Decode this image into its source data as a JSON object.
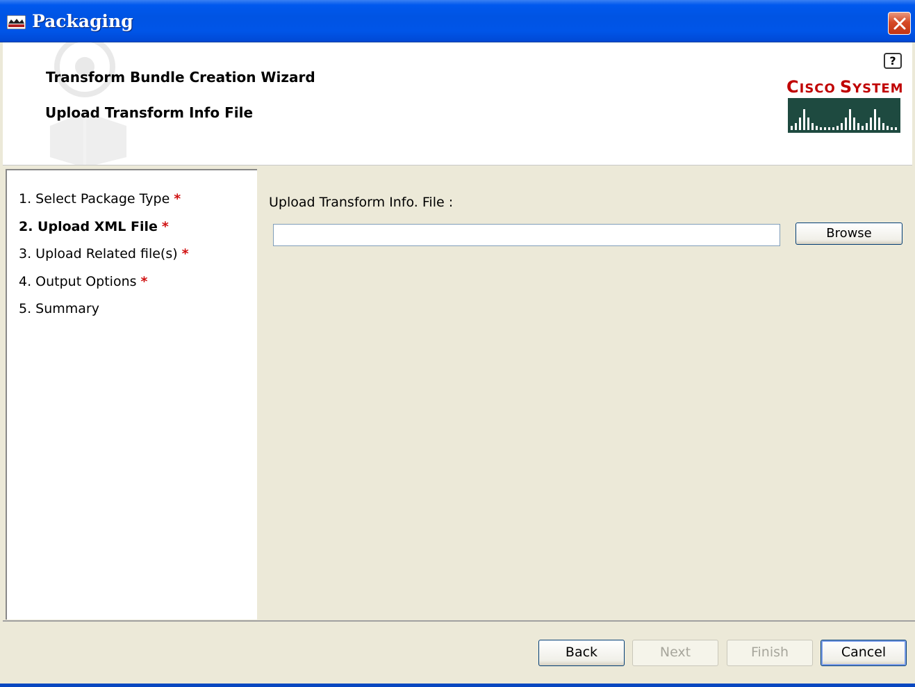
{
  "window": {
    "title": "Packaging",
    "app_icon": "packaging-app-icon",
    "close_icon": "close-icon"
  },
  "header": {
    "wizard_title": "Transform Bundle Creation Wizard",
    "step_title": "Upload Transform Info File",
    "help_label": "?",
    "logo_text": "Cisco Systems"
  },
  "steps": [
    {
      "label": "1. Select Package Type",
      "required": "*",
      "current": false
    },
    {
      "label": "2. Upload XML File",
      "required": "*",
      "current": true
    },
    {
      "label": "3. Upload Related file(s)",
      "required": "*",
      "current": false
    },
    {
      "label": "4. Output Options",
      "required": "*",
      "current": false
    },
    {
      "label": "5. Summary",
      "required": "",
      "current": false
    }
  ],
  "content": {
    "upload_label": "Upload Transform Info. File :",
    "file_value": "",
    "browse_label": "Browse"
  },
  "footer": {
    "back_label": "Back",
    "next_label": "Next",
    "finish_label": "Finish",
    "cancel_label": "Cancel"
  },
  "colors": {
    "titlebar": "#0054e3",
    "panel_bg": "#ece9d8",
    "required_star": "#d01010",
    "cisco_red": "#c00000"
  }
}
